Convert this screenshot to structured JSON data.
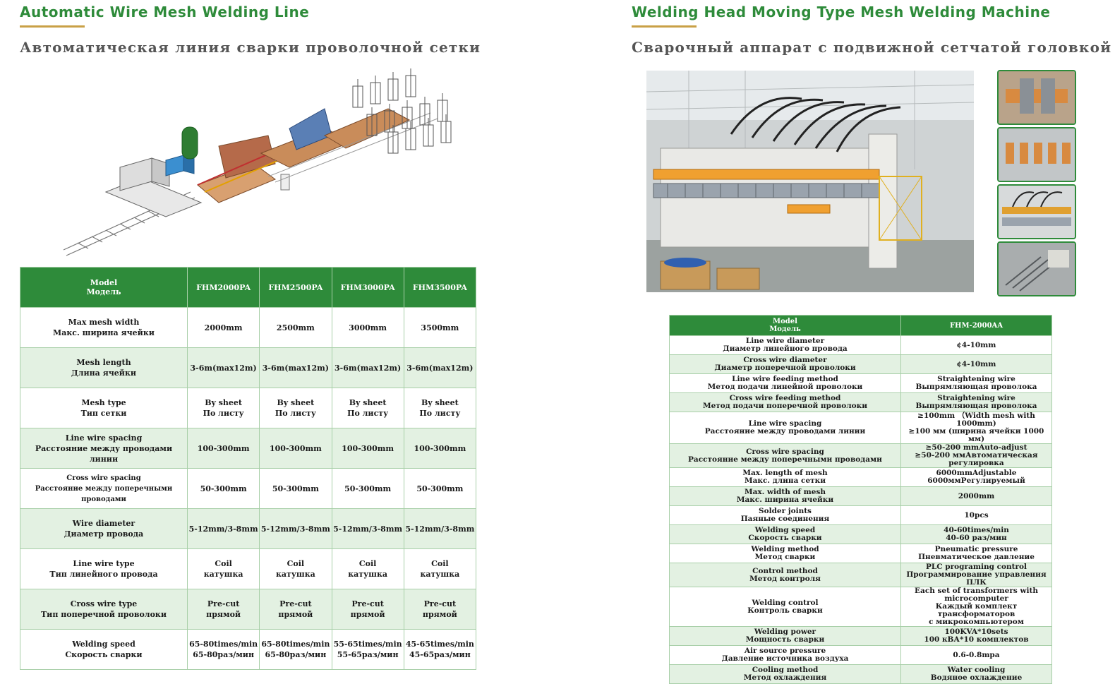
{
  "left": {
    "title_en": "Automatic Wire Mesh Welding Line",
    "title_ru": "Автоматическая линия сварки проволочной сетки",
    "table": {
      "header": {
        "label": [
          "Model",
          "Модель"
        ],
        "models": [
          "FHM2000PA",
          "FHM2500PA",
          "FHM3000PA",
          "FHM3500PA"
        ]
      },
      "rows": [
        {
          "label": [
            "Max mesh width",
            "Макс. ширина ячейки"
          ],
          "values": [
            [
              "2000mm"
            ],
            [
              "2500mm"
            ],
            [
              "3000mm"
            ],
            [
              "3500mm"
            ]
          ]
        },
        {
          "label": [
            "Mesh length",
            "Длина ячейки"
          ],
          "values": [
            [
              "3-6m(max12m)"
            ],
            [
              "3-6m(max12m)"
            ],
            [
              "3-6m(max12m)"
            ],
            [
              "3-6m(max12m)"
            ]
          ]
        },
        {
          "label": [
            "Mesh type",
            "Тип сетки"
          ],
          "values": [
            [
              "By sheet",
              "По листу"
            ],
            [
              "By sheet",
              "По листу"
            ],
            [
              "By sheet",
              "По листу"
            ],
            [
              "By sheet",
              "По листу"
            ]
          ]
        },
        {
          "label": [
            "Line wire spacing",
            "Расстояние между проводами линии"
          ],
          "values": [
            [
              "100-300mm"
            ],
            [
              "100-300mm"
            ],
            [
              "100-300mm"
            ],
            [
              "100-300mm"
            ]
          ]
        },
        {
          "label": [
            "Cross wire spacing",
            "Расстояние между поперечными проводами"
          ],
          "values": [
            [
              "50-300mm"
            ],
            [
              "50-300mm"
            ],
            [
              "50-300mm"
            ],
            [
              "50-300mm"
            ]
          ]
        },
        {
          "label": [
            "Wire diameter",
            "Диаметр провода"
          ],
          "values": [
            [
              "5-12mm/3-8mm"
            ],
            [
              "5-12mm/3-8mm"
            ],
            [
              "5-12mm/3-8mm"
            ],
            [
              "5-12mm/3-8mm"
            ]
          ]
        },
        {
          "label": [
            "Line wire type",
            "Тип линейного провода"
          ],
          "values": [
            [
              "Coil",
              "катушка"
            ],
            [
              "Coil",
              "катушка"
            ],
            [
              "Coil",
              "катушка"
            ],
            [
              "Coil",
              "катушка"
            ]
          ]
        },
        {
          "label": [
            "Cross wire type",
            "Тип поперечной проволоки"
          ],
          "values": [
            [
              "Pre-cut",
              "прямой"
            ],
            [
              "Pre-cut",
              "прямой"
            ],
            [
              "Pre-cut",
              "прямой"
            ],
            [
              "Pre-cut",
              "прямой"
            ]
          ]
        },
        {
          "label": [
            "Welding speed",
            "Скорость сварки"
          ],
          "values": [
            [
              "65-80times/min",
              "65-80раз/мин"
            ],
            [
              "65-80times/min",
              "65-80раз/мин"
            ],
            [
              "55-65times/min",
              "55-65раз/мин"
            ],
            [
              "45-65times/min",
              "45-65раз/мин"
            ]
          ]
        }
      ]
    }
  },
  "right": {
    "title_en": "Welding Head Moving Type Mesh Welding Machine",
    "title_ru": "Сварочный аппарат с подвижной сетчатой головкой",
    "table": {
      "header": {
        "label": [
          "Model",
          "Модель"
        ],
        "model": "FHM-2000AA"
      },
      "rows": [
        {
          "label": [
            "Line wire diameter",
            "Диаметр линейного провода"
          ],
          "value": [
            "¢4-10mm"
          ]
        },
        {
          "label": [
            "Cross wire diameter",
            "Диаметр поперечной проволоки"
          ],
          "value": [
            "¢4-10mm"
          ]
        },
        {
          "label": [
            "Line wire feeding method",
            "Метод подачи линейной проволоки"
          ],
          "value": [
            "Straightening wire",
            "Выпрямляющая проволока"
          ]
        },
        {
          "label": [
            "Cross wire feeding method",
            "Метод подачи поперечной проволоки"
          ],
          "value": [
            "Straightening wire",
            "Выпрямляющая проволока"
          ]
        },
        {
          "label": [
            "Line wire spacing",
            "Расстояние между проводами линии"
          ],
          "value": [
            "≥100mm （Width mesh with 1000mm)",
            "≥100 мм (ширина ячейки 1000 мм)"
          ]
        },
        {
          "label": [
            "Cross wire spacing",
            "Расстояние между поперечными проводами"
          ],
          "value": [
            "≥50-200 mmAuto-adjust",
            "≥50-200 ммАвтоматическая регулировка"
          ]
        },
        {
          "label": [
            "Max. length of mesh",
            "Макс. длина сетки"
          ],
          "value": [
            "6000mmAdjustable",
            "6000ммРегулируемый"
          ]
        },
        {
          "label": [
            "Max. width of mesh",
            "Макс. ширина ячейки"
          ],
          "value": [
            "2000mm"
          ]
        },
        {
          "label": [
            "Solder joints",
            "Паяные соединения"
          ],
          "value": [
            "10pcs"
          ]
        },
        {
          "label": [
            "Welding speed",
            "Скорость сварки"
          ],
          "value": [
            "40-60times/min",
            "40-60 раз/мин"
          ]
        },
        {
          "label": [
            "Welding method",
            "Метод сварки"
          ],
          "value": [
            "Pneumatic pressure",
            "Пневматическое давление"
          ]
        },
        {
          "label": [
            "Control method",
            "Метод контроля"
          ],
          "value": [
            "PLC programing control",
            "Программирование управления ПЛК"
          ]
        },
        {
          "label": [
            "Welding control",
            "Контроль сварки"
          ],
          "value": [
            "Each set of transformers with",
            "microcomputer",
            "Каждый комплект трансформаторов",
            "с микрокомпьютером"
          ]
        },
        {
          "label": [
            "Welding power",
            "Мощность сварки"
          ],
          "value": [
            "100KVA*10sets",
            "100 кВА*10 комплектов"
          ]
        },
        {
          "label": [
            "Air source pressure",
            "Давление источника воздуха"
          ],
          "value": [
            "0.6-0.8mpa"
          ]
        },
        {
          "label": [
            "Cooling method",
            "Метод охлаждения"
          ],
          "value": [
            "Water cooling",
            "Водяное охлаждение"
          ]
        }
      ]
    }
  },
  "colors": {
    "green": "#2e8b3a",
    "light_green": "#e3f1e2",
    "gold": "#c9a046",
    "gray_text": "#555555"
  }
}
